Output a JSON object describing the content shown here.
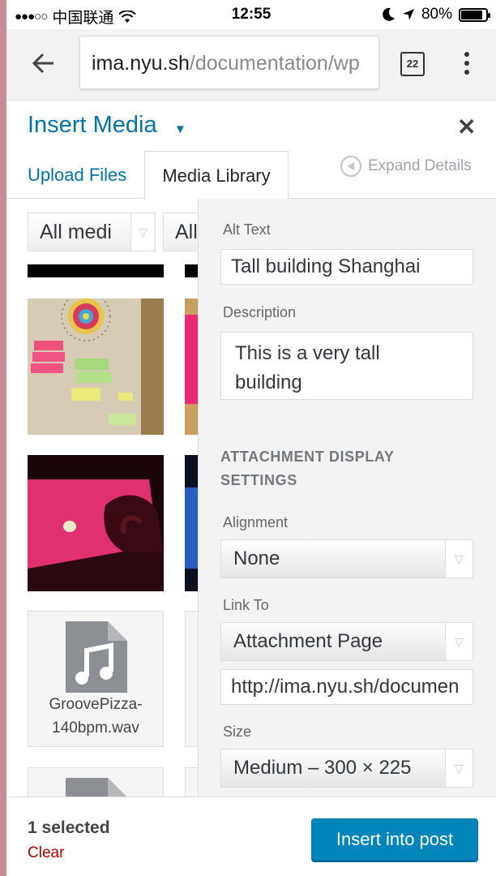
{
  "status_bar": {
    "carrier": "中国联通",
    "time": "12:55",
    "battery": "80%",
    "battery_level": 0.8
  },
  "browser": {
    "url_host": "ima.nyu.sh",
    "url_path": "/documentation/wp",
    "tab_count": "22",
    "back_icon": "arrow-left-icon",
    "menu_icon": "vertical-dots-icon"
  },
  "modal": {
    "title": "Insert Media",
    "tabs": {
      "upload": "Upload Files",
      "library": "Media Library"
    },
    "expand_details": "Expand Details"
  },
  "filters": {
    "media_type": "All medi",
    "date": "All"
  },
  "media_items": [
    {
      "type": "image",
      "description": "sticky notes on paper"
    },
    {
      "type": "image",
      "description": "pink screen"
    },
    {
      "type": "image",
      "description": "hand over pink laptop screen"
    },
    {
      "type": "image",
      "description": "blue screen"
    },
    {
      "type": "audio",
      "filename": "GroovePizza-140bpm.wav",
      "line1": "GroovePizza-",
      "line2": "140bpm.wav"
    }
  ],
  "details": {
    "alt_text_label": "Alt Text",
    "alt_text_value": "Tall building Shanghai",
    "description_label": "Description",
    "description_line1": "This is a very tall",
    "description_line2": "building",
    "display_settings_heading_line1": "ATTACHMENT DISPLAY",
    "display_settings_heading_line2": "SETTINGS",
    "alignment_label": "Alignment",
    "alignment_value": "None",
    "link_to_label": "Link To",
    "link_to_value": "Attachment Page",
    "link_url": "http://ima.nyu.sh/documen",
    "size_label": "Size",
    "size_value": "Medium – 300 × 225"
  },
  "footer": {
    "selected_count": "1 selected",
    "clear": "Clear",
    "insert_button": "Insert into post"
  },
  "colors": {
    "accent": "#0073aa",
    "button": "#0085ba",
    "clear": "#aa0000"
  }
}
